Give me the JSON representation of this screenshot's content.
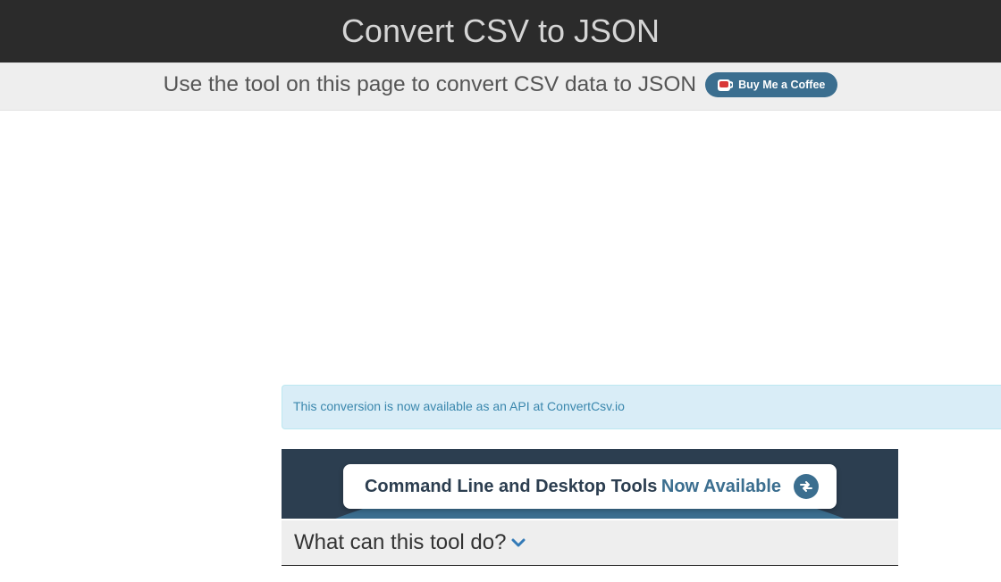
{
  "header": {
    "title": "Convert CSV to JSON"
  },
  "subtitle": {
    "text": "Use the tool on this page to convert CSV data to JSON",
    "coffee_label": "Buy Me a Coffee"
  },
  "info": {
    "text": "This conversion is now available as an API at ",
    "link_text": "ConvertCsv.io"
  },
  "promo": {
    "primary": "Command Line and Desktop Tools",
    "secondary": "Now Available"
  },
  "section": {
    "title": "What can this tool do?"
  }
}
